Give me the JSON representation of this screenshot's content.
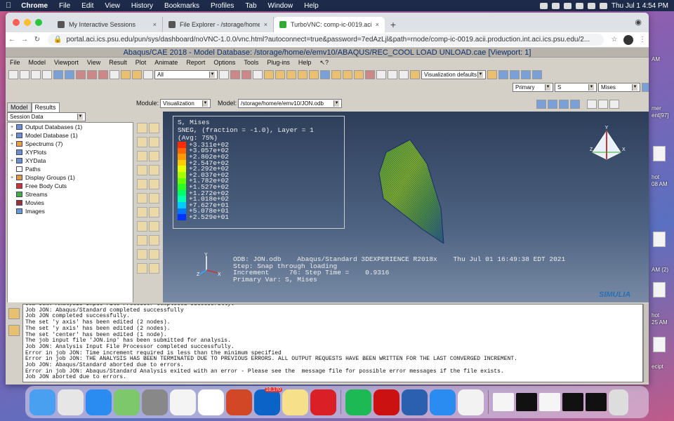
{
  "menubar": {
    "app": "Chrome",
    "items": [
      "File",
      "Edit",
      "View",
      "History",
      "Bookmarks",
      "Profiles",
      "Tab",
      "Window",
      "Help"
    ],
    "clock": "Thu Jul 1  4:54 PM"
  },
  "desktop": {
    "labels": [
      "AM",
      "mer",
      "ent[97]",
      "hot",
      "08 AM",
      "AM (2)",
      "hot",
      "25 AM",
      "ecipt"
    ]
  },
  "browser": {
    "tabs": [
      {
        "title": "My Interactive Sessions"
      },
      {
        "title": "File Explorer - /storage/home/e"
      },
      {
        "title": "TurboVNC: comp-ic-0019.acii"
      }
    ],
    "url": "portal.aci.ics.psu.edu/pun/sys/dashboard/noVNC-1.0.0/vnc.html?autoconnect=true&password=7edAzLjl&path=rnode/comp-ic-0019.acii.production.int.aci.ics.psu.edu/2..."
  },
  "abaqus": {
    "title": "Abaqus/CAE 2018 - Model Database: /storage/home/e/emv10/ABAQUS/REC_COOL LOAD UNLOAD.cae [Viewport: 1]",
    "menu": [
      "File",
      "Model",
      "Viewport",
      "View",
      "Result",
      "Plot",
      "Animate",
      "Report",
      "Options",
      "Tools",
      "Plug-ins",
      "Help",
      "↖?"
    ],
    "toolbar_all": "All",
    "vis_defaults": "Visualization defaults",
    "primary": "Primary",
    "primary_num": "S",
    "primary_var": "Mises",
    "module_label": "Module:",
    "module_value": "Visualization",
    "model_label": "Model:",
    "model_value": "/storage/home/e/emv10/JON.odb",
    "tree_tabs": [
      "Model",
      "Results"
    ],
    "session_data": "Session Data",
    "tree": [
      {
        "ex": "+",
        "label": "Output Databases (1)"
      },
      {
        "ex": "+",
        "label": "Model Database (1)"
      },
      {
        "ex": "+",
        "label": "Spectrums (7)"
      },
      {
        "ex": "",
        "label": "XYPlots"
      },
      {
        "ex": "+",
        "label": "XYData"
      },
      {
        "ex": "",
        "label": "Paths"
      },
      {
        "ex": "+",
        "label": "Display Groups (1)"
      },
      {
        "ex": "",
        "label": "Free Body Cuts"
      },
      {
        "ex": "",
        "label": "Streams"
      },
      {
        "ex": "",
        "label": "Movies"
      },
      {
        "ex": "",
        "label": "Images"
      }
    ],
    "legend": {
      "header": [
        "S, Mises",
        "SNEG, (fraction = -1.0), Layer = 1",
        "(Avg: 75%)"
      ],
      "values": [
        "+3.311e+02",
        "+3.057e+02",
        "+2.802e+02",
        "+2.547e+02",
        "+2.292e+02",
        "+2.037e+02",
        "+1.782e+02",
        "+1.527e+02",
        "+1.272e+02",
        "+1.018e+02",
        "+7.627e+01",
        "+5.078e+01",
        "+2.529e+01"
      ],
      "colors": [
        "#ff2a00",
        "#ff6600",
        "#ff9900",
        "#ffcc00",
        "#e6ff00",
        "#a8ff00",
        "#66ff00",
        "#2bff22",
        "#00ff66",
        "#00ffb0",
        "#00ccff",
        "#0077ff",
        "#0033ff"
      ]
    },
    "odb": [
      "ODB: JON.odb    Abaqus/Standard 3DEXPERIENCE R2018x    Thu Jul 01 16:49:38 EDT 2021",
      "Step: Snap through loading",
      "Increment     76: Step Time =    0.9316",
      "Primary Var: S, Mises"
    ],
    "triad": {
      "y": "Y",
      "x": "X",
      "z": "Z"
    },
    "brand": "SIMULIA",
    "messages": [
      "Job JON: Analysis Input File Processor completed successfully.",
      "Job JON: Abaqus/Standard completed successfully",
      "Job JON completed successfully.",
      "The set 'y axis' has been edited (2 nodes).",
      "The set 'y axis' has been edited (2 nodes).",
      "The set 'center' has been edited (1 node).",
      "The job input file 'JON.inp' has been submitted for analysis.",
      "Job JON: Analysis Input File Processor completed successfully.",
      "Error in job JON: Time increment required is less than the minimum specified",
      "Error in job JON: THE ANALYSIS HAS BEEN TERMINATED DUE TO PREVIOUS ERRORS. ALL OUTPUT REQUESTS HAVE BEEN WRITTEN FOR THE LAST CONVERGED INCREMENT.",
      "Job JON: Abaqus/Standard aborted due to errors.",
      "Error in job JON: Abaqus/Standard Analysis exited with an error - Please see the  message file for possible error messages if the file exists.",
      "Job JON aborted due to errors."
    ]
  },
  "dock": {
    "apps": [
      {
        "name": "finder-icon",
        "color": "#4aa0f0"
      },
      {
        "name": "launchpad-icon",
        "color": "#e6e6e6"
      },
      {
        "name": "app-store-icon",
        "color": "#2a8cf0"
      },
      {
        "name": "maps-icon",
        "color": "#7cc86a"
      },
      {
        "name": "system-preferences-icon",
        "color": "#888"
      },
      {
        "name": "photos-icon",
        "color": "#f4f4f4"
      },
      {
        "name": "slack-icon",
        "color": "#fff"
      },
      {
        "name": "powerpoint-icon",
        "color": "#d24726"
      },
      {
        "name": "outlook-icon",
        "color": "#0a64c8"
      },
      {
        "name": "notes-icon",
        "color": "#f6e08a"
      },
      {
        "name": "creative-cloud-icon",
        "color": "#da1f26"
      },
      {
        "name": "spotify-icon",
        "color": "#1db954"
      },
      {
        "name": "acrobat-icon",
        "color": "#c11"
      },
      {
        "name": "word-icon",
        "color": "#2b5fb0"
      },
      {
        "name": "safari-icon",
        "color": "#2a8cf0"
      },
      {
        "name": "chrome-icon",
        "color": "#f2f2f2"
      }
    ],
    "outlook_badge": "10,170"
  }
}
